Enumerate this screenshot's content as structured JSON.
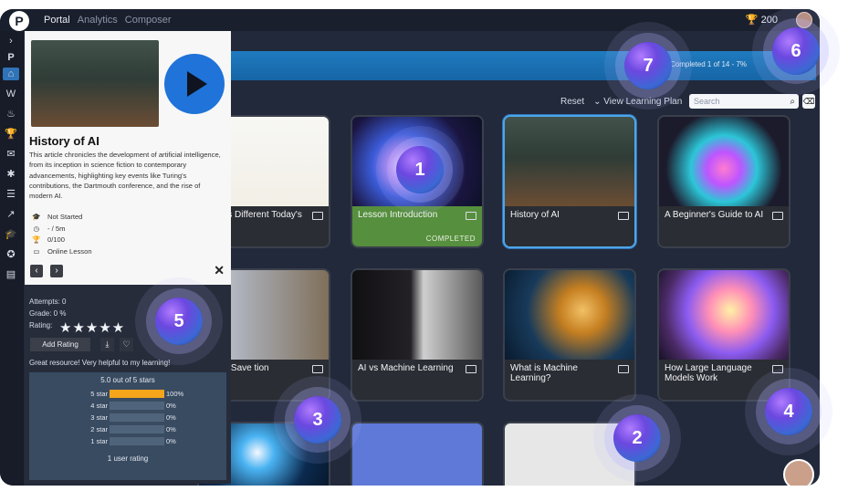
{
  "topbar": {
    "logo_letter": "P",
    "nav": [
      "Portal",
      "Analytics",
      "Composer"
    ],
    "active_nav": "Portal",
    "trophy_count": "200"
  },
  "progress": {
    "label": "Completed  1 of 14 - 7%",
    "fraction": 0.07
  },
  "toolbar": {
    "reset_label": "Reset",
    "view_plan_label": "View Learning Plan",
    "search_placeholder": "Search"
  },
  "cards": [
    {
      "title": "What's Different Today's AI",
      "status": ""
    },
    {
      "title": "Lesson Introduction",
      "status": "COMPLETED"
    },
    {
      "title": "History of AI",
      "status": ""
    },
    {
      "title": "A Beginner's Guide to AI",
      "status": ""
    },
    {
      "title": "Could Save tion",
      "status": ""
    },
    {
      "title": "AI vs Machine Learning",
      "status": ""
    },
    {
      "title": "What is Machine Learning?",
      "status": ""
    },
    {
      "title": "How Large Language Models Work",
      "status": ""
    }
  ],
  "panel": {
    "title": "History of AI",
    "description": "This article chronicles the development of artificial intelligence, from its inception in science fiction to contemporary advancements, highlighting key events like Turing's contributions, the Dartmouth conference, and the rise of modern AI.",
    "status": "Not Started",
    "time": "- / 5m",
    "score": "0/100",
    "type": "Online Lesson",
    "attempts_label": "Attempts:  0",
    "grade_label": "Grade:  0 %",
    "rating_label": "Rating:",
    "stars_display": "★★★★★",
    "add_rating_label": "Add Rating",
    "review_text": "Great resource! Very helpful to my learning!",
    "rating_summary": "5.0 out of 5 stars",
    "rating_rows": [
      {
        "label": "5 star",
        "pct": "100%",
        "value": 1.0
      },
      {
        "label": "4 star",
        "pct": "0%",
        "value": 0.0
      },
      {
        "label": "3 star",
        "pct": "0%",
        "value": 0.0
      },
      {
        "label": "2 star",
        "pct": "0%",
        "value": 0.0
      },
      {
        "label": "1 star",
        "pct": "0%",
        "value": 0.0
      }
    ],
    "user_rating_count": "1 user rating"
  },
  "badges": [
    "1",
    "2",
    "3",
    "4",
    "5",
    "6",
    "7"
  ],
  "icons": {
    "accent": "#1f73d9",
    "banner": "#1f7bbf",
    "completed_green": "#568f3d",
    "rating_fill": "#f4a51a"
  }
}
